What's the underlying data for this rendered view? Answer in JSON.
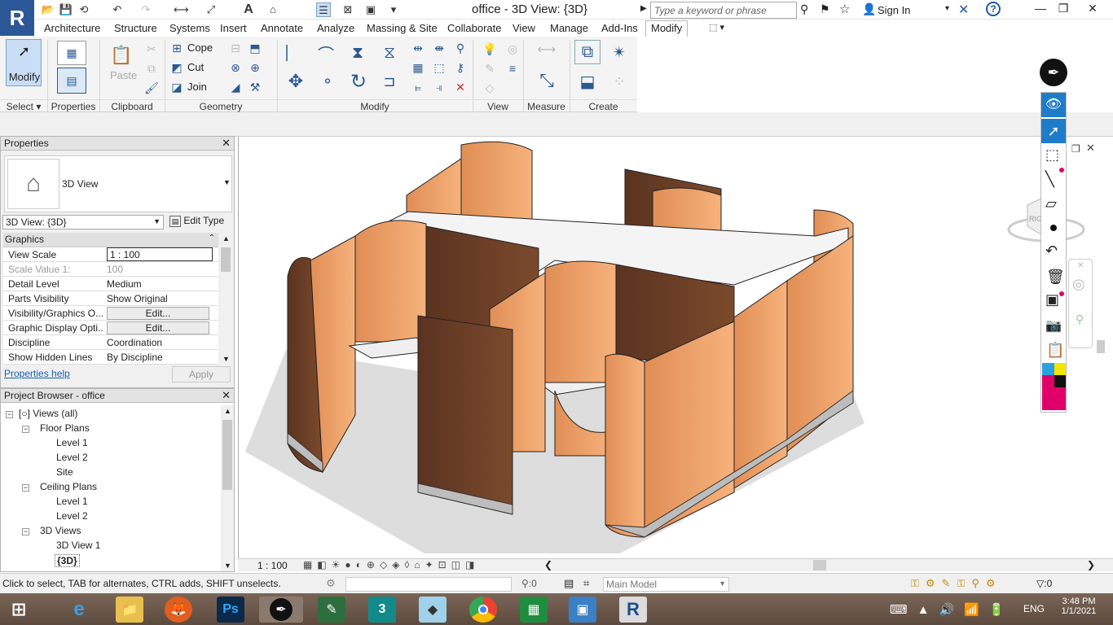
{
  "app": {
    "title": "office - 3D View: {3D}",
    "logo": "R"
  },
  "search": {
    "placeholder": "Type a keyword or phrase"
  },
  "account": {
    "signin": "Sign In"
  },
  "tabs": [
    "Architecture",
    "Structure",
    "Systems",
    "Insert",
    "Annotate",
    "Analyze",
    "Massing & Site",
    "Collaborate",
    "View",
    "Manage",
    "Add-Ins",
    "Modify"
  ],
  "ribbon": {
    "modify_label": "Modify",
    "select_label": "Select",
    "paste_label": "Paste",
    "cope_label": "Cope",
    "cut_label": "Cut",
    "join_label": "Join",
    "panels": [
      "Select",
      "Properties",
      "Clipboard",
      "Geometry",
      "Modify",
      "View",
      "Measure",
      "Create"
    ]
  },
  "properties": {
    "title": "Properties",
    "type_name": "3D View",
    "selector": "3D View: {3D}",
    "edit_type": "Edit Type",
    "section": "Graphics",
    "rows": [
      {
        "key": "View Scale",
        "value": "1 : 100"
      },
      {
        "key": "Scale Value    1:",
        "value": "100"
      },
      {
        "key": "Detail Level",
        "value": "Medium"
      },
      {
        "key": "Parts Visibility",
        "value": "Show Original"
      },
      {
        "key": "Visibility/Graphics O...",
        "value": "Edit..."
      },
      {
        "key": "Graphic Display Opti...",
        "value": "Edit..."
      },
      {
        "key": "Discipline",
        "value": "Coordination"
      },
      {
        "key": "Show Hidden Lines",
        "value": "By Discipline"
      }
    ],
    "help": "Properties help",
    "apply": "Apply"
  },
  "browser": {
    "title": "Project Browser - office",
    "root": "Views (all)",
    "floor_plans": "Floor Plans",
    "fp_items": [
      "Level 1",
      "Level 2",
      "Site"
    ],
    "ceiling_plans": "Ceiling Plans",
    "cp_items": [
      "Level 1",
      "Level 2"
    ],
    "views3d": "3D Views",
    "v3_items": [
      "3D View 1",
      "{3D}"
    ]
  },
  "viewbar": {
    "scale": "1 : 100"
  },
  "status": {
    "hint": "Click to select, TAB for alternates, CTRL adds, SHIFT unselects.",
    "count": ":0",
    "model": "Main Model",
    "filter": ":0"
  },
  "taskbar": {
    "lang": "ENG",
    "time": "3:48 PM",
    "date": "1/1/2021"
  },
  "colors": {
    "panel_light": "#f4a870",
    "panel_dark": "#6b3f24",
    "accent": "#2b5797"
  }
}
